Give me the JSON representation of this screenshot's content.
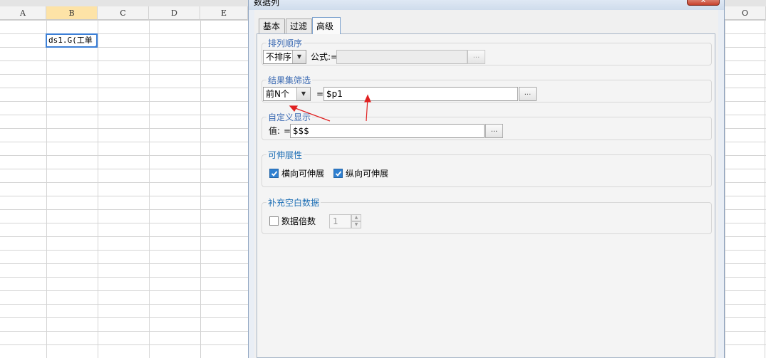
{
  "sheet": {
    "columns": [
      "A",
      "B",
      "C",
      "D",
      "E"
    ],
    "selected_column": "B",
    "right_column": "O",
    "active_cell_value": "ds1.G(工单"
  },
  "dialog": {
    "title": "数据列",
    "close_glyph": "x",
    "tabs": [
      {
        "label": "基本",
        "active": false
      },
      {
        "label": "过滤",
        "active": false
      },
      {
        "label": "高级",
        "active": true
      }
    ],
    "sort": {
      "title": "排列顺序",
      "order_value": "不排序",
      "formula_label": "公式:=",
      "formula_value": "",
      "dots": "..."
    },
    "result_filter": {
      "title": "结果集筛选",
      "mode_value": "前N个",
      "equals": "=",
      "value": "$p1",
      "dots": "..."
    },
    "custom_display": {
      "title": "自定义显示",
      "value_label": "值:",
      "equals": "=",
      "value": "$$$",
      "dots": "..."
    },
    "expand": {
      "title": "可伸展性",
      "horizontal_label": "横向可伸展",
      "horizontal_checked": true,
      "vertical_label": "纵向可伸展",
      "vertical_checked": true
    },
    "fill_blank": {
      "title": "补充空白数据",
      "multiple_label": "数据倍数",
      "multiple_checked": false,
      "multiple_value": "1"
    }
  },
  "colors": {
    "accent": "#2f80d1",
    "annotation_arrow": "#e02020",
    "group_title": "#3d6bb3"
  }
}
